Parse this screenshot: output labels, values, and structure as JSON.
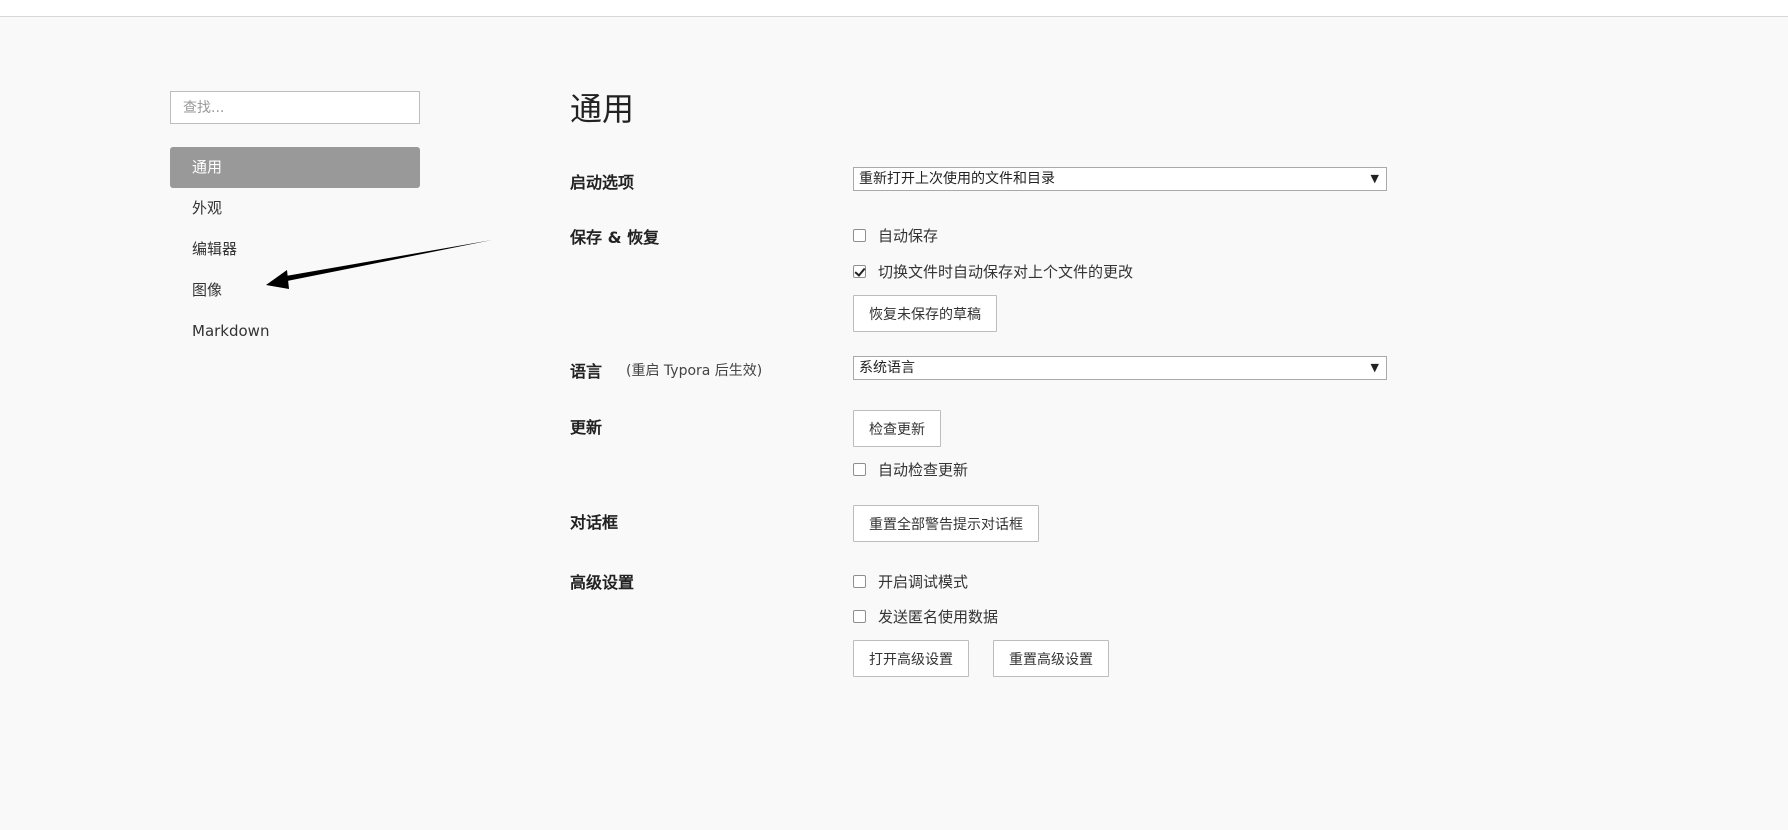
{
  "sidebar": {
    "search_placeholder": "查找...",
    "items": [
      {
        "label": "通用",
        "active": true
      },
      {
        "label": "外观",
        "active": false
      },
      {
        "label": "编辑器",
        "active": false
      },
      {
        "label": "图像",
        "active": false
      },
      {
        "label": "Markdown",
        "active": false
      }
    ]
  },
  "main": {
    "title": "通用",
    "startup": {
      "label": "启动选项",
      "select_value": "重新打开上次使用的文件和目录"
    },
    "save_restore": {
      "label": "保存 & 恢复",
      "auto_save": {
        "label": "自动保存",
        "checked": false
      },
      "save_on_switch": {
        "label": "切换文件时自动保存对上个文件的更改",
        "checked": true
      },
      "restore_button": "恢复未保存的草稿"
    },
    "language": {
      "label": "语言",
      "note": "(重启 Typora 后生效)",
      "select_value": "系统语言"
    },
    "update": {
      "label": "更新",
      "check_button": "检查更新",
      "auto_check": {
        "label": "自动检查更新",
        "checked": false
      }
    },
    "dialog": {
      "label": "对话框",
      "reset_button": "重置全部警告提示对话框"
    },
    "advanced": {
      "label": "高级设置",
      "debug_mode": {
        "label": "开启调试模式",
        "checked": false
      },
      "send_usage": {
        "label": "发送匿名使用数据",
        "checked": false
      },
      "open_button": "打开高级设置",
      "reset_button": "重置高级设置"
    }
  },
  "icons": {
    "select_caret": "▼",
    "annotation": "arrow-annotation"
  },
  "colors": {
    "active_nav_bg": "#999999",
    "page_bg": "#f9f9f9"
  }
}
